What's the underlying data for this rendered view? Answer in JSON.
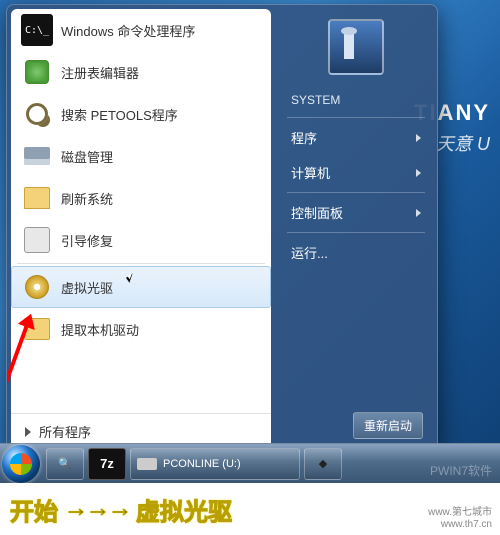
{
  "desktop": {
    "brand_en": "TIANY",
    "brand_cn": "天意 U"
  },
  "startmenu": {
    "items": [
      {
        "label": "Windows 命令处理程序",
        "icon": "cmd"
      },
      {
        "label": "注册表编辑器",
        "icon": "reg"
      },
      {
        "label": "搜索 PETOOLS程序",
        "icon": "search"
      },
      {
        "label": "磁盘管理",
        "icon": "disk"
      },
      {
        "label": "刷新系统",
        "icon": "refresh"
      },
      {
        "label": "引导修复",
        "icon": "boot"
      },
      {
        "label": "虚拟光驱",
        "icon": "cd",
        "hover": true
      },
      {
        "label": "提取本机驱动",
        "icon": "drv"
      }
    ],
    "all_programs": "所有程序",
    "user": "SYSTEM",
    "right": [
      {
        "label": "程序",
        "chev": true
      },
      {
        "label": "计算机",
        "chev": true
      },
      {
        "label": "控制面板",
        "chev": true
      },
      {
        "label": "运行...",
        "chev": false
      }
    ],
    "restart": "重新启动"
  },
  "taskbar": {
    "drive_label": "PCONLINE (U:)",
    "sevenz": "7z"
  },
  "footer": {
    "t1": "开始",
    "arrows": "→→→",
    "t2": "虚拟光驱"
  },
  "watermark": {
    "brand": "PWIN7软件",
    "site": "www.第七城市",
    "url": "www.th7.cn"
  }
}
